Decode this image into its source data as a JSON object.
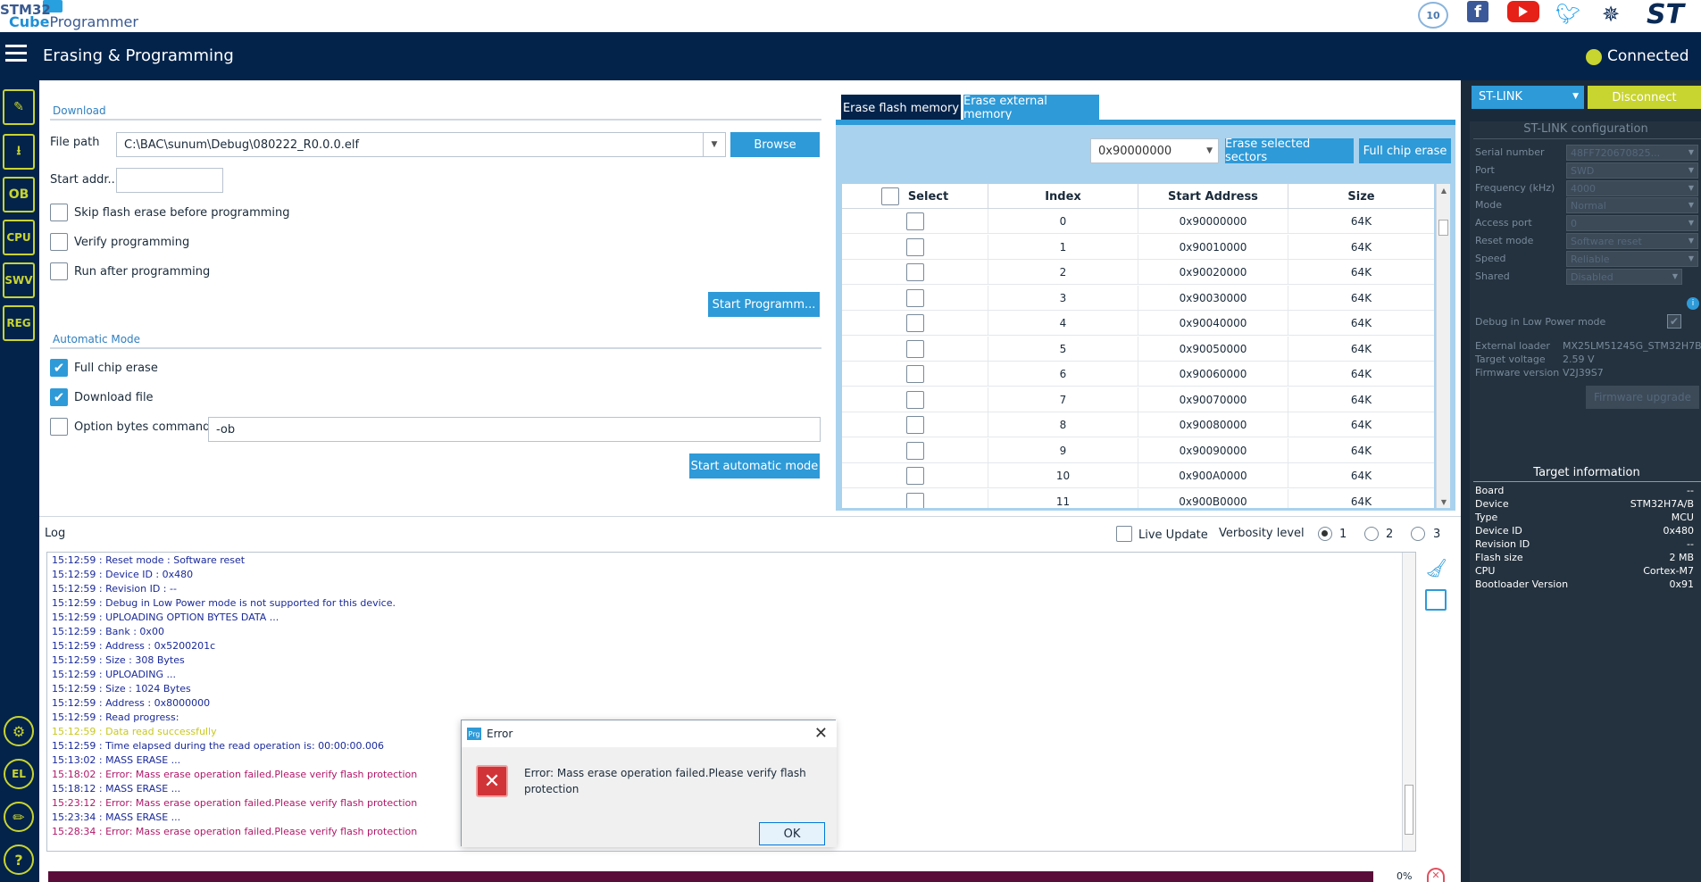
{
  "brand": {
    "line1": "STM32",
    "line2a": "Cube",
    "line2b": "Programmer",
    "anniversary": "10",
    "facebook": "f",
    "st_logo": "ST"
  },
  "titlebar": {
    "title": "Erasing & Programming",
    "status": "Connected",
    "status_color": "#c8d430"
  },
  "rail": {
    "items": [
      "edit-icon",
      "download-icon",
      "OB",
      "CPU",
      "SWV",
      "REG"
    ],
    "bottom": [
      "beta-icon",
      "el-icon",
      "pen-icon",
      "?"
    ]
  },
  "download": {
    "section": "Download",
    "file_path_label": "File path",
    "file_path_value": "C:\\BAC\\sunum\\Debug\\080222_R0.0.0.elf",
    "browse": "Browse",
    "start_addr_label": "Start addr...",
    "start_addr_value": "",
    "skip_erase": "Skip flash erase before programming",
    "verify": "Verify programming",
    "run_after": "Run after programming",
    "start_programming": "Start Programm..."
  },
  "automatic": {
    "section": "Automatic Mode",
    "full_chip_erase": "Full chip erase",
    "download_file": "Download file",
    "option_bytes": "Option bytes commands",
    "option_bytes_value": "-ob",
    "start_auto": "Start automatic mode"
  },
  "erase": {
    "tab_flash": "Erase flash memory",
    "tab_external": "Erase external memory",
    "address_select": "0x90000000",
    "erase_selected": "Erase selected sectors",
    "full_chip_erase": "Full chip erase",
    "headers": [
      "Select",
      "Index",
      "Start Address",
      "Size"
    ],
    "rows": [
      {
        "index": "0",
        "address": "0x90000000",
        "size": "64K"
      },
      {
        "index": "1",
        "address": "0x90010000",
        "size": "64K"
      },
      {
        "index": "2",
        "address": "0x90020000",
        "size": "64K"
      },
      {
        "index": "3",
        "address": "0x90030000",
        "size": "64K"
      },
      {
        "index": "4",
        "address": "0x90040000",
        "size": "64K"
      },
      {
        "index": "5",
        "address": "0x90050000",
        "size": "64K"
      },
      {
        "index": "6",
        "address": "0x90060000",
        "size": "64K"
      },
      {
        "index": "7",
        "address": "0x90070000",
        "size": "64K"
      },
      {
        "index": "8",
        "address": "0x90080000",
        "size": "64K"
      },
      {
        "index": "9",
        "address": "0x90090000",
        "size": "64K"
      },
      {
        "index": "10",
        "address": "0x900A0000",
        "size": "64K"
      },
      {
        "index": "11",
        "address": "0x900B0000",
        "size": "64K"
      }
    ]
  },
  "stlink": {
    "selector": "ST-LINK",
    "disconnect": "Disconnect",
    "config_title": "ST-LINK configuration",
    "fields": [
      {
        "label": "Serial number",
        "value": "48FF720670825..."
      },
      {
        "label": "Port",
        "value": "SWD"
      },
      {
        "label": "Frequency (kHz)",
        "value": "4000"
      },
      {
        "label": "Mode",
        "value": "Normal"
      },
      {
        "label": "Access port",
        "value": "0"
      },
      {
        "label": "Reset mode",
        "value": "Software reset"
      },
      {
        "label": "Speed",
        "value": "Reliable"
      },
      {
        "label": "Shared",
        "value": "Disabled"
      }
    ],
    "debug_low_power": "Debug in Low Power mode",
    "external_loader_label": "External loader",
    "external_loader_value": "MX25LM51245G_STM32H7B...",
    "target_voltage_label": "Target voltage",
    "target_voltage_value": "2.59 V",
    "firmware_version_label": "Firmware version",
    "firmware_version_value": "V2J39S7",
    "firmware_upgrade": "Firmware upgrade"
  },
  "target_info": {
    "title": "Target information",
    "rows": [
      {
        "label": "Board",
        "value": "--"
      },
      {
        "label": "Device",
        "value": "STM32H7A/B"
      },
      {
        "label": "Type",
        "value": "MCU"
      },
      {
        "label": "Device ID",
        "value": "0x480"
      },
      {
        "label": "Revision ID",
        "value": "--"
      },
      {
        "label": "Flash size",
        "value": "2 MB"
      },
      {
        "label": "CPU",
        "value": "Cortex-M7"
      },
      {
        "label": "Bootloader Version",
        "value": "0x91"
      }
    ]
  },
  "log": {
    "title": "Log",
    "live_update": "Live Update",
    "verbosity_label": "Verbosity level",
    "levels": [
      "1",
      "2",
      "3"
    ],
    "progress": "0%",
    "lines": [
      {
        "text": "15:12:59 : Reset mode  : Software reset",
        "kind": "info"
      },
      {
        "text": "15:12:59 : Device ID   : 0x480",
        "kind": "info"
      },
      {
        "text": "15:12:59 : Revision ID : --",
        "kind": "info"
      },
      {
        "text": "15:12:59 : Debug in Low Power mode is not supported for this device.",
        "kind": "info"
      },
      {
        "text": "15:12:59 : UPLOADING OPTION BYTES DATA ...",
        "kind": "info"
      },
      {
        "text": "15:12:59 :   Bank          : 0x00",
        "kind": "info"
      },
      {
        "text": "15:12:59 :   Address       : 0x5200201c",
        "kind": "info"
      },
      {
        "text": "15:12:59 :   Size          : 308 Bytes",
        "kind": "info"
      },
      {
        "text": "15:12:59 : UPLOADING ...",
        "kind": "info"
      },
      {
        "text": "15:12:59 :   Size          : 1024 Bytes",
        "kind": "info"
      },
      {
        "text": "15:12:59 :   Address       : 0x8000000",
        "kind": "info"
      },
      {
        "text": "15:12:59 : Read progress:",
        "kind": "info"
      },
      {
        "text": "15:12:59 : Data read successfully",
        "kind": "success"
      },
      {
        "text": "15:12:59 : Time elapsed during the read operation is: 00:00:00.006",
        "kind": "info"
      },
      {
        "text": "15:13:02 : MASS ERASE ...",
        "kind": "info"
      },
      {
        "text": "15:18:02 : Error: Mass erase operation failed.Please verify flash protection",
        "kind": "error"
      },
      {
        "text": "15:18:12 : MASS ERASE ...",
        "kind": "info"
      },
      {
        "text": "15:23:12 : Error: Mass erase operation failed.Please verify flash protection",
        "kind": "error"
      },
      {
        "text": "15:23:34 : MASS ERASE ...",
        "kind": "info"
      },
      {
        "text": "15:28:34 : Error: Mass erase operation failed.Please verify flash protection",
        "kind": "error"
      }
    ]
  },
  "dialog": {
    "caption": "Error",
    "app_badge": "Prg",
    "message": "Error: Mass erase operation failed.Please verify flash protection",
    "ok": "OK"
  },
  "colors": {
    "navy": "#03234b",
    "accent": "#2e9ad8",
    "lime": "#c8d430",
    "log_info": "#1a2a9a",
    "log_success": "#c8c820",
    "log_error": "#b0186a"
  }
}
